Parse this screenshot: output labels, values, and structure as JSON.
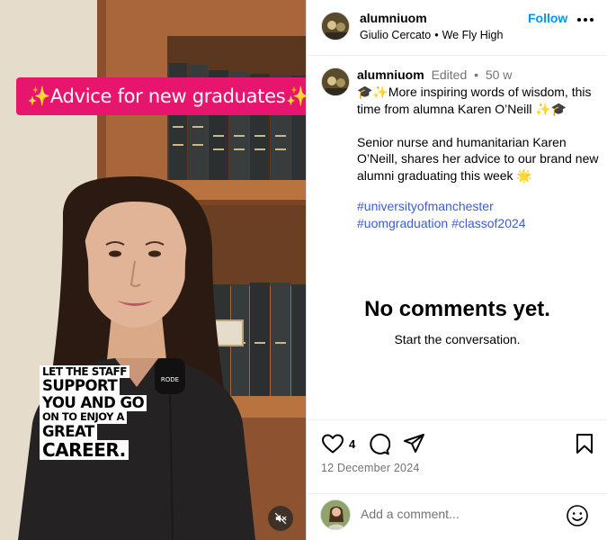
{
  "media": {
    "banner_text": "✨Advice for new graduates✨",
    "overlay_lines": [
      "LET THE STAFF",
      "SUPPORT",
      "YOU AND GO",
      "ON TO ENJOY A",
      "GREAT",
      "CAREER."
    ],
    "mic_label": "RODE",
    "mute_icon": "speaker-muted-icon"
  },
  "header": {
    "username": "alumniuom",
    "follow_label": "Follow",
    "subtitle_left": "Giulio Cercato",
    "subtitle_sep": "•",
    "subtitle_right": "We Fly High",
    "more_icon": "more-horizontal-icon"
  },
  "caption": {
    "username": "alumniuom",
    "edited": "Edited",
    "sep": "•",
    "time": "50 w",
    "body": "🎓✨More inspiring words of wisdom, this time from alumna Karen O’Neill ✨🎓\n\nSenior nurse and humanitarian Karen O’Neill, shares her advice to our brand new alumni graduating this week 🌟",
    "hashtags": [
      "#universityofmanchester",
      "#uomgraduation",
      "#classof2024"
    ]
  },
  "comments": {
    "empty_title": "No comments yet.",
    "empty_subtitle": "Start the conversation."
  },
  "actions": {
    "like_count": "4",
    "date": "12 December 2024",
    "icons": [
      "heart-icon",
      "comment-icon",
      "share-icon",
      "bookmark-icon"
    ]
  },
  "comment_bar": {
    "placeholder": "Add a comment...",
    "emoji_icon": "smiley-icon"
  },
  "colors": {
    "follow": "#0095f6",
    "hashtag": "#3b5bdb",
    "banner": "#e8156e",
    "muted_text": "#737373"
  }
}
